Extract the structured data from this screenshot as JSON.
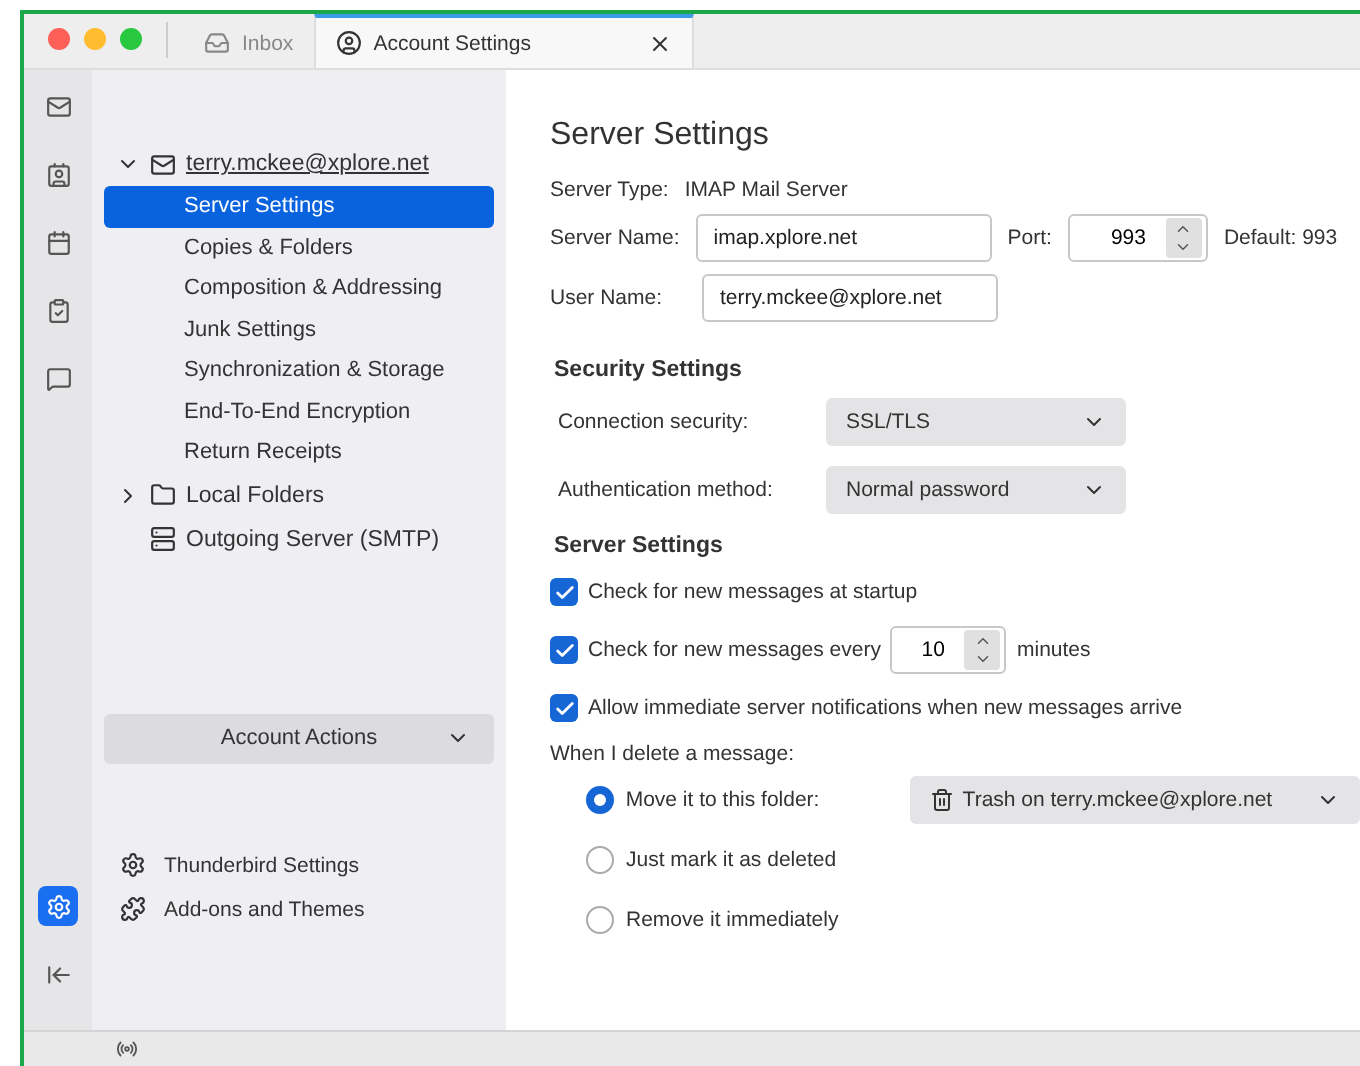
{
  "tabs": [
    {
      "label": "Inbox",
      "kind": "mail",
      "selected": false
    },
    {
      "label": "Account Settings",
      "kind": "account",
      "selected": true
    }
  ],
  "rail": [
    {
      "kind": "mail",
      "selected": false
    },
    {
      "kind": "contacts",
      "selected": false
    },
    {
      "kind": "calendar",
      "selected": false
    },
    {
      "kind": "tasks",
      "selected": false
    },
    {
      "kind": "chat",
      "selected": false
    }
  ],
  "rail_bottom": [
    {
      "kind": "settings",
      "selected": true
    },
    {
      "kind": "collapse",
      "selected": false
    }
  ],
  "sidebar": {
    "tree": [
      {
        "label": "terry.mckee@xplore.net",
        "kind": "account",
        "expanded": true,
        "children": [
          {
            "label": "Server Settings",
            "selected": true
          },
          {
            "label": "Copies & Folders",
            "selected": false
          },
          {
            "label": "Composition & Addressing",
            "selected": false
          },
          {
            "label": "Junk Settings",
            "selected": false
          },
          {
            "label": "Synchronization & Storage",
            "selected": false
          },
          {
            "label": "End-To-End Encryption",
            "selected": false
          },
          {
            "label": "Return Receipts",
            "selected": false
          }
        ]
      },
      {
        "label": "Local Folders",
        "kind": "folder",
        "expanded": false
      },
      {
        "label": "Outgoing Server (SMTP)",
        "kind": "server"
      }
    ],
    "account_actions": "Account Actions",
    "links": [
      {
        "label": "Thunderbird Settings",
        "kind": "settings"
      },
      {
        "label": "Add-ons and Themes",
        "kind": "addons"
      }
    ]
  },
  "content": {
    "title": "Server Settings",
    "server_type": {
      "label": "Server Type:",
      "value": "IMAP Mail Server"
    },
    "server_name": {
      "label": "Server Name:",
      "value": "imap.xplore.net"
    },
    "port": {
      "label": "Port:",
      "value": "993",
      "default": "Default: 993"
    },
    "user_name": {
      "label": "User Name:",
      "value": "terry.mckee@xplore.net"
    },
    "security": {
      "heading": "Security Settings",
      "fields": [
        {
          "label": "Connection security:",
          "value": "SSL/TLS"
        },
        {
          "label": "Authentication method:",
          "value": "Normal password"
        }
      ]
    },
    "server": {
      "heading": "Server Settings",
      "checks": [
        {
          "kind": "plain",
          "label": "Check for new messages at startup",
          "checked": true
        },
        {
          "kind": "interval",
          "label": "Check for new messages every",
          "value": "10",
          "suffix": "minutes",
          "checked": true
        },
        {
          "kind": "plain",
          "label": "Allow immediate server notifications when new messages arrive",
          "checked": true
        }
      ]
    },
    "delete": {
      "label": "When I delete a message:",
      "options": [
        {
          "label": "Move it to this folder:",
          "selected": true,
          "folder": "Trash on terry.mckee@xplore.net"
        },
        {
          "label": "Just mark it as deleted",
          "selected": false
        },
        {
          "label": "Remove it immediately",
          "selected": false
        }
      ]
    }
  }
}
